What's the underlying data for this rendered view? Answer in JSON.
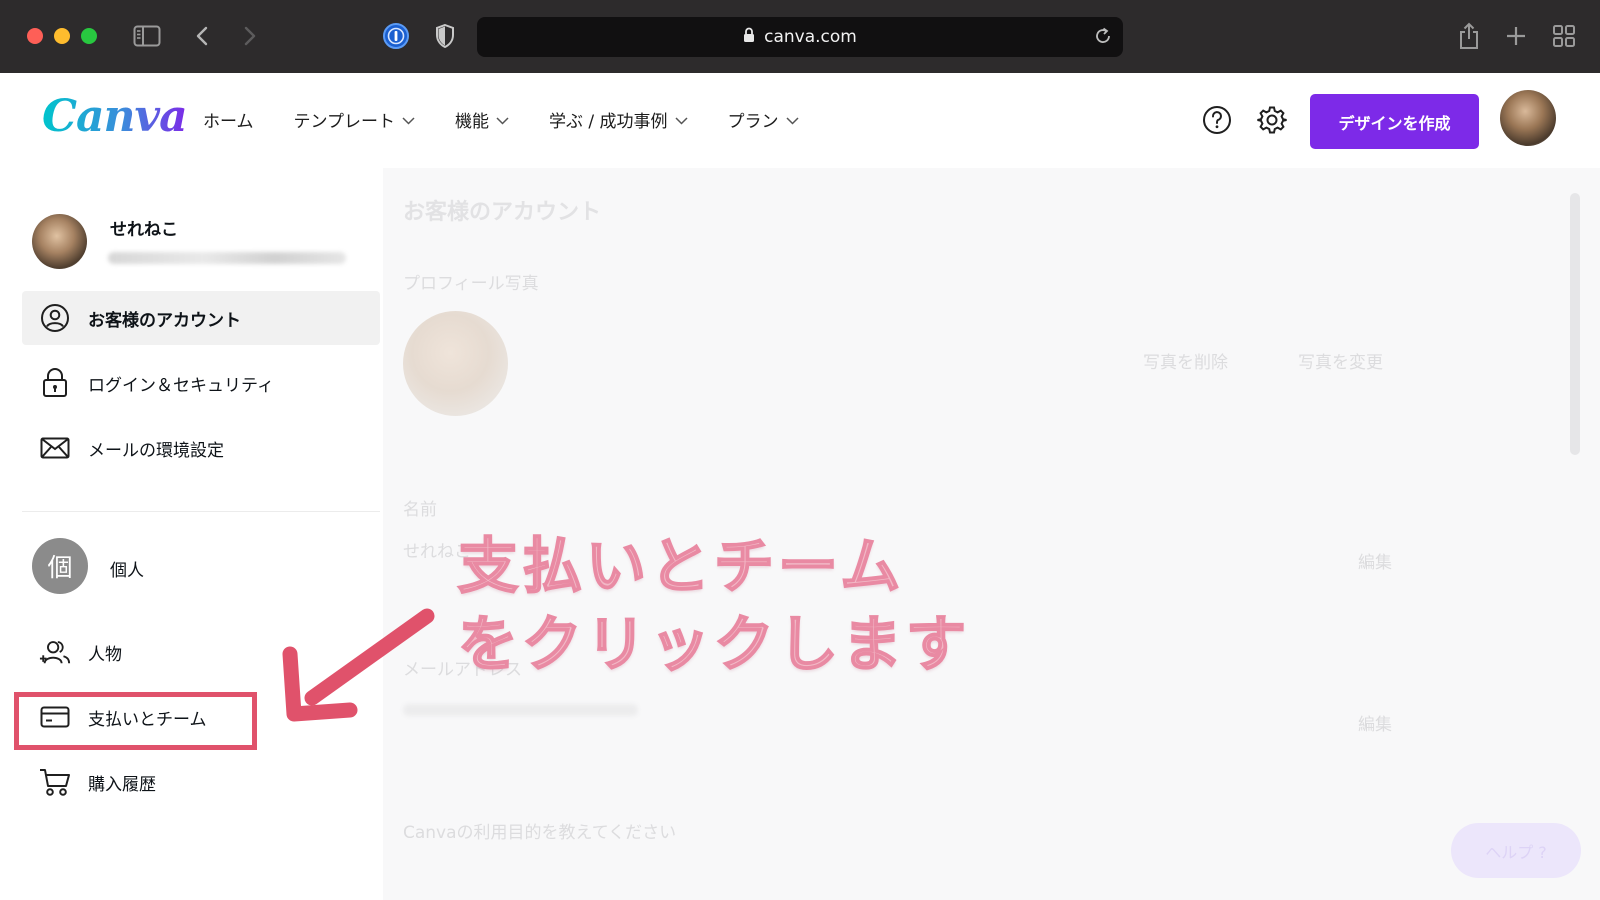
{
  "browser": {
    "url": "canva.com"
  },
  "header": {
    "logo": "Canva",
    "nav": [
      {
        "label": "ホーム",
        "has_menu": false
      },
      {
        "label": "テンプレート",
        "has_menu": true
      },
      {
        "label": "機能",
        "has_menu": true
      },
      {
        "label": "学ぶ / 成功事例",
        "has_menu": true
      },
      {
        "label": "プラン",
        "has_menu": true
      }
    ],
    "create_button": "デザインを作成",
    "accent_color": "#7d2ae8"
  },
  "sidebar": {
    "profile_name": "せれねこ",
    "account_items": [
      {
        "label": "お客様のアカウント",
        "icon": "user-circle-icon",
        "active": true
      },
      {
        "label": "ログイン＆セキュリティ",
        "icon": "lock-icon",
        "active": false
      },
      {
        "label": "メールの環境設定",
        "icon": "mail-icon",
        "active": false
      }
    ],
    "team": {
      "badge": "個",
      "label": "個人"
    },
    "team_items": [
      {
        "label": "人物",
        "icon": "people-add-icon"
      },
      {
        "label": "支払いとチーム",
        "icon": "credit-card-icon",
        "highlighted": true
      },
      {
        "label": "購入履歴",
        "icon": "cart-icon"
      }
    ]
  },
  "main": {
    "title": "お客様のアカウント",
    "profile_photo_label": "プロフィール写真",
    "delete_photo": "写真を削除",
    "change_photo": "写真を変更",
    "name_label": "名前",
    "name_value": "せれねこ",
    "edit": "編集",
    "email_label": "メールアドレス",
    "purpose_label": "Canvaの利用目的を教えてください",
    "help_button": "ヘルプ ?"
  },
  "annotation": {
    "line1": "支払いとチーム",
    "line2": "をクリックします",
    "color": "#e0526b"
  }
}
